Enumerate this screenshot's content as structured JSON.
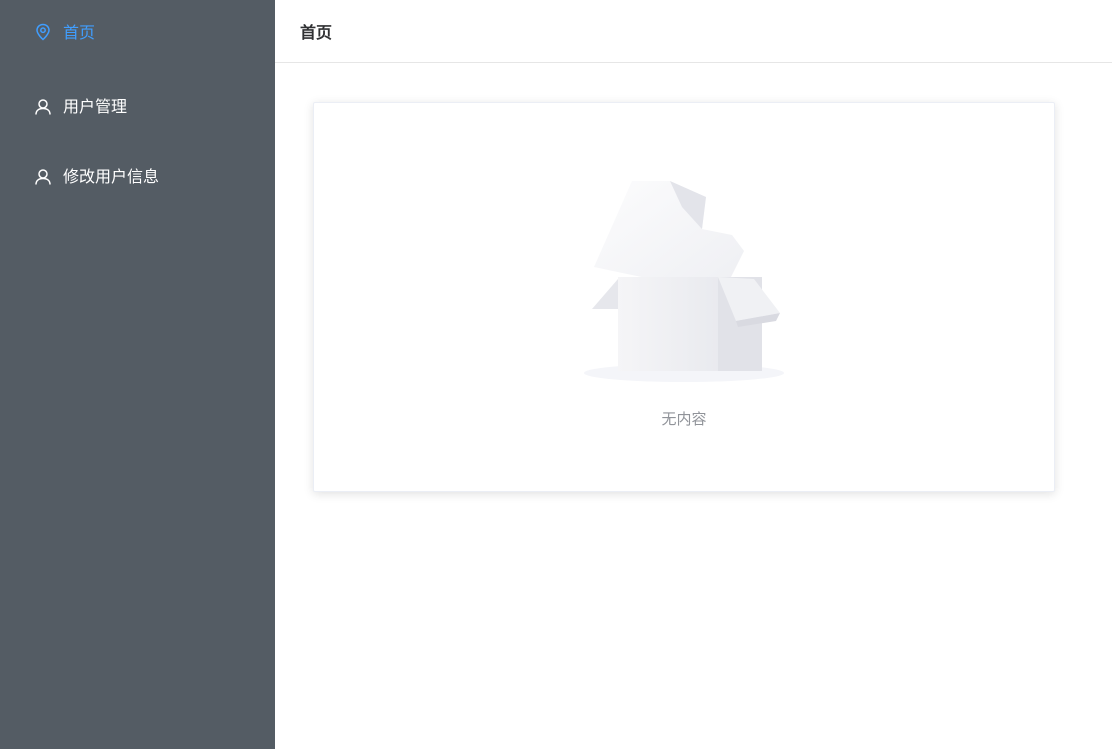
{
  "sidebar": {
    "items": [
      {
        "label": "首页",
        "icon": "location-icon",
        "active": true
      },
      {
        "label": "用户管理",
        "icon": "user-icon",
        "active": false
      },
      {
        "label": "修改用户信息",
        "icon": "user-icon",
        "active": false
      }
    ]
  },
  "header": {
    "title": "首页"
  },
  "main": {
    "empty": {
      "text": "无内容",
      "icon": "empty-box-icon"
    }
  },
  "colors": {
    "sidebar_bg": "#545c64",
    "accent": "#409eff",
    "menu_text": "#ffffff",
    "empty_text": "#909399"
  }
}
